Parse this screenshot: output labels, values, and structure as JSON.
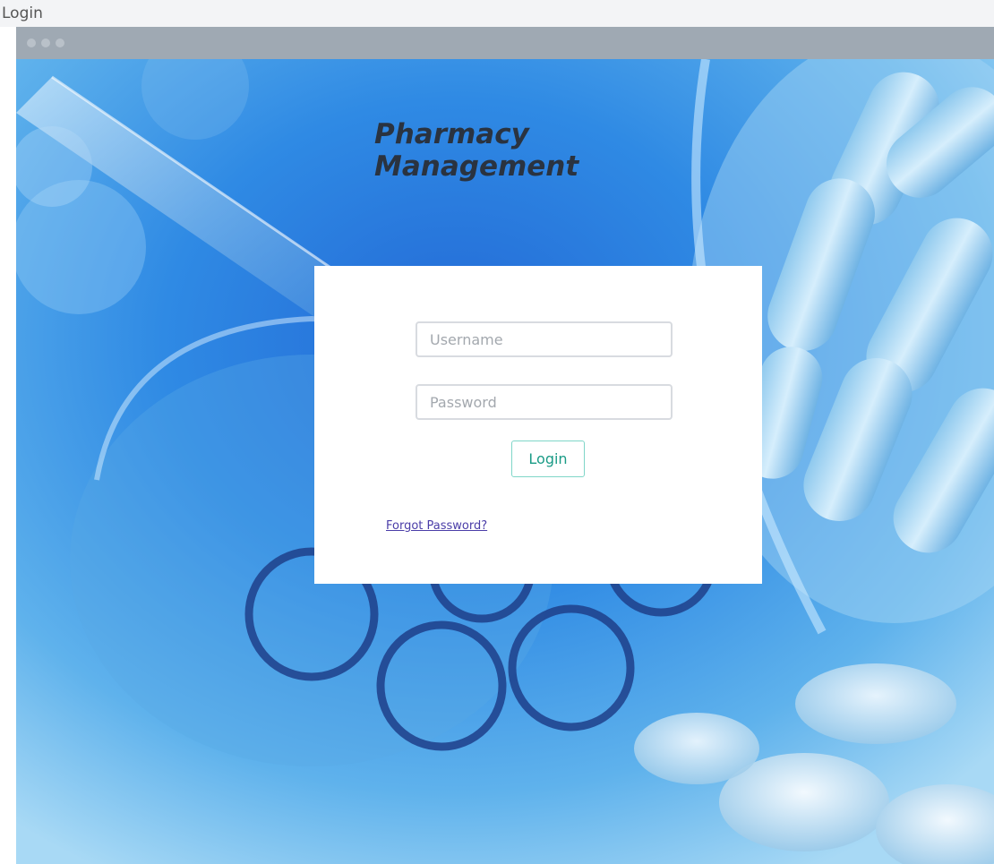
{
  "window": {
    "title": "Login"
  },
  "header": {
    "app_title": "Pharmacy Management"
  },
  "login": {
    "username_placeholder": "Username",
    "password_placeholder": "Password",
    "login_label": "Login",
    "forgot_label": "Forgot Password?"
  },
  "colors": {
    "accent": "#1a9b86",
    "link": "#4a3da8",
    "background": "#2a7fe0"
  },
  "icons": [
    "window-control-dots",
    "pill-capsules-image",
    "test-tubes-image"
  ]
}
